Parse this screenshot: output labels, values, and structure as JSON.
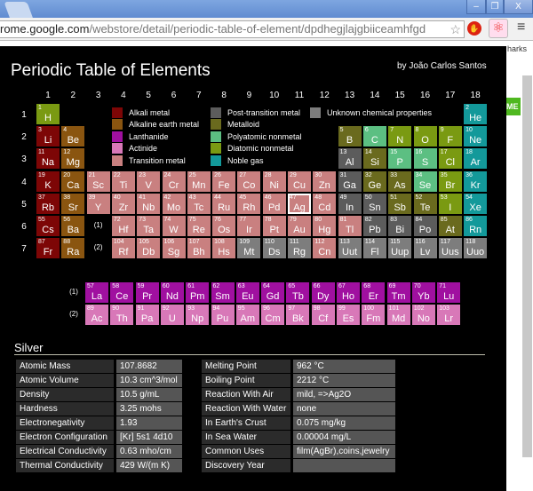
{
  "browser": {
    "url_host": "rome.google.com",
    "url_path": "/webstore/detail/periodic-table-of-element/dpdhegjlajgbiiceamhfgd",
    "bookmarks_partial": "harks",
    "page_button_partial": "ME",
    "window_buttons": [
      "–",
      "❐",
      "X"
    ]
  },
  "popup": {
    "title": "Periodic Table of Elements",
    "author": "by João Carlos Santos"
  },
  "colors": {
    "am": "#7d0606",
    "ae": "#8a5510",
    "la": "#a010a0",
    "ac": "#d878b8",
    "tm": "#c98080",
    "pt": "#5c5c5c",
    "ml": "#6a6a1e",
    "pn": "#5cbf82",
    "dn": "#7a9a12",
    "ng": "#13999a",
    "un": "#7d7d7d"
  },
  "legend": [
    {
      "cat": "am",
      "label": "Alkali metal"
    },
    {
      "cat": "ae",
      "label": "Alkaline earth metal"
    },
    {
      "cat": "la",
      "label": "Lanthanide"
    },
    {
      "cat": "ac",
      "label": "Actinide"
    },
    {
      "cat": "tm",
      "label": "Transition metal"
    },
    {
      "cat": "pt",
      "label": "Post-transition metal"
    },
    {
      "cat": "ml",
      "label": "Metalloid"
    },
    {
      "cat": "pn",
      "label": "Polyatomic nonmetal"
    },
    {
      "cat": "dn",
      "label": "Diatomic nonmetal"
    },
    {
      "cat": "ng",
      "label": "Noble gas"
    },
    {
      "cat": "un",
      "label": "Unknown chemical properties"
    }
  ],
  "groups": [
    "1",
    "2",
    "3",
    "4",
    "5",
    "6",
    "7",
    "8",
    "9",
    "10",
    "11",
    "12",
    "13",
    "14",
    "15",
    "16",
    "17",
    "18"
  ],
  "periods": [
    "1",
    "2",
    "3",
    "4",
    "5",
    "6",
    "7"
  ],
  "series_markers": [
    "(1)",
    "(2)"
  ],
  "selected": "47",
  "elements": [
    [
      "1",
      "H",
      "dn",
      1,
      1
    ],
    [
      "2",
      "He",
      "ng",
      18,
      1
    ],
    [
      "3",
      "Li",
      "am",
      1,
      2
    ],
    [
      "4",
      "Be",
      "ae",
      2,
      2
    ],
    [
      "5",
      "B",
      "ml",
      13,
      2
    ],
    [
      "6",
      "C",
      "pn",
      14,
      2
    ],
    [
      "7",
      "N",
      "dn",
      15,
      2
    ],
    [
      "8",
      "O",
      "dn",
      16,
      2
    ],
    [
      "9",
      "F",
      "dn",
      17,
      2
    ],
    [
      "10",
      "Ne",
      "ng",
      18,
      2
    ],
    [
      "11",
      "Na",
      "am",
      1,
      3
    ],
    [
      "12",
      "Mg",
      "ae",
      2,
      3
    ],
    [
      "13",
      "Al",
      "pt",
      13,
      3
    ],
    [
      "14",
      "Si",
      "ml",
      14,
      3
    ],
    [
      "15",
      "P",
      "pn",
      15,
      3
    ],
    [
      "16",
      "S",
      "pn",
      16,
      3
    ],
    [
      "17",
      "Cl",
      "dn",
      17,
      3
    ],
    [
      "18",
      "Ar",
      "ng",
      18,
      3
    ],
    [
      "19",
      "K",
      "am",
      1,
      4
    ],
    [
      "20",
      "Ca",
      "ae",
      2,
      4
    ],
    [
      "21",
      "Sc",
      "tm",
      3,
      4
    ],
    [
      "22",
      "Ti",
      "tm",
      4,
      4
    ],
    [
      "23",
      "V",
      "tm",
      5,
      4
    ],
    [
      "24",
      "Cr",
      "tm",
      6,
      4
    ],
    [
      "25",
      "Mn",
      "tm",
      7,
      4
    ],
    [
      "26",
      "Fe",
      "tm",
      8,
      4
    ],
    [
      "27",
      "Co",
      "tm",
      9,
      4
    ],
    [
      "28",
      "Ni",
      "tm",
      10,
      4
    ],
    [
      "29",
      "Cu",
      "tm",
      11,
      4
    ],
    [
      "30",
      "Zn",
      "tm",
      12,
      4
    ],
    [
      "31",
      "Ga",
      "pt",
      13,
      4
    ],
    [
      "32",
      "Ge",
      "ml",
      14,
      4
    ],
    [
      "33",
      "As",
      "ml",
      15,
      4
    ],
    [
      "34",
      "Se",
      "pn",
      16,
      4
    ],
    [
      "35",
      "Br",
      "dn",
      17,
      4
    ],
    [
      "36",
      "Kr",
      "ng",
      18,
      4
    ],
    [
      "37",
      "Rb",
      "am",
      1,
      5
    ],
    [
      "38",
      "Sr",
      "ae",
      2,
      5
    ],
    [
      "39",
      "Y",
      "tm",
      3,
      5
    ],
    [
      "40",
      "Zr",
      "tm",
      4,
      5
    ],
    [
      "41",
      "Nb",
      "tm",
      5,
      5
    ],
    [
      "42",
      "Mo",
      "tm",
      6,
      5
    ],
    [
      "43",
      "Tc",
      "tm",
      7,
      5
    ],
    [
      "44",
      "Ru",
      "tm",
      8,
      5
    ],
    [
      "45",
      "Rh",
      "tm",
      9,
      5
    ],
    [
      "46",
      "Pd",
      "tm",
      10,
      5
    ],
    [
      "47",
      "Ag",
      "tm",
      11,
      5
    ],
    [
      "48",
      "Cd",
      "tm",
      12,
      5
    ],
    [
      "49",
      "In",
      "pt",
      13,
      5
    ],
    [
      "50",
      "Sn",
      "pt",
      14,
      5
    ],
    [
      "51",
      "Sb",
      "ml",
      15,
      5
    ],
    [
      "52",
      "Te",
      "ml",
      16,
      5
    ],
    [
      "53",
      "I",
      "dn",
      17,
      5
    ],
    [
      "54",
      "Xe",
      "ng",
      18,
      5
    ],
    [
      "55",
      "Cs",
      "am",
      1,
      6
    ],
    [
      "56",
      "Ba",
      "ae",
      2,
      6
    ],
    [
      "72",
      "Hf",
      "tm",
      4,
      6
    ],
    [
      "73",
      "Ta",
      "tm",
      5,
      6
    ],
    [
      "74",
      "W",
      "tm",
      6,
      6
    ],
    [
      "75",
      "Re",
      "tm",
      7,
      6
    ],
    [
      "76",
      "Os",
      "tm",
      8,
      6
    ],
    [
      "77",
      "Ir",
      "tm",
      9,
      6
    ],
    [
      "78",
      "Pt",
      "tm",
      10,
      6
    ],
    [
      "79",
      "Au",
      "tm",
      11,
      6
    ],
    [
      "80",
      "Hg",
      "tm",
      12,
      6
    ],
    [
      "81",
      "Tl",
      "tm",
      13,
      6
    ],
    [
      "82",
      "Pb",
      "pt",
      14,
      6
    ],
    [
      "83",
      "Bi",
      "pt",
      15,
      6
    ],
    [
      "84",
      "Po",
      "pt",
      16,
      6
    ],
    [
      "85",
      "At",
      "ml",
      17,
      6
    ],
    [
      "86",
      "Rn",
      "ng",
      18,
      6
    ],
    [
      "87",
      "Fr",
      "am",
      1,
      7
    ],
    [
      "88",
      "Ra",
      "ae",
      2,
      7
    ],
    [
      "104",
      "Rf",
      "tm",
      4,
      7
    ],
    [
      "105",
      "Db",
      "tm",
      5,
      7
    ],
    [
      "106",
      "Sg",
      "tm",
      6,
      7
    ],
    [
      "107",
      "Bh",
      "tm",
      7,
      7
    ],
    [
      "108",
      "Hs",
      "tm",
      8,
      7
    ],
    [
      "109",
      "Mt",
      "un",
      9,
      7
    ],
    [
      "110",
      "Ds",
      "un",
      10,
      7
    ],
    [
      "111",
      "Rg",
      "un",
      11,
      7
    ],
    [
      "112",
      "Cn",
      "tm",
      12,
      7
    ],
    [
      "113",
      "Uut",
      "un",
      13,
      7
    ],
    [
      "114",
      "Fl",
      "un",
      14,
      7
    ],
    [
      "115",
      "Uup",
      "un",
      15,
      7
    ],
    [
      "116",
      "Lv",
      "un",
      16,
      7
    ],
    [
      "117",
      "Uus",
      "un",
      17,
      7
    ],
    [
      "118",
      "Uuo",
      "un",
      18,
      7
    ]
  ],
  "lanthanides": [
    [
      "57",
      "La"
    ],
    [
      "58",
      "Ce"
    ],
    [
      "59",
      "Pr"
    ],
    [
      "60",
      "Nd"
    ],
    [
      "61",
      "Pm"
    ],
    [
      "62",
      "Sm"
    ],
    [
      "63",
      "Eu"
    ],
    [
      "64",
      "Gd"
    ],
    [
      "65",
      "Tb"
    ],
    [
      "66",
      "Dy"
    ],
    [
      "67",
      "Ho"
    ],
    [
      "68",
      "Er"
    ],
    [
      "69",
      "Tm"
    ],
    [
      "70",
      "Yb"
    ],
    [
      "71",
      "Lu"
    ]
  ],
  "actinides": [
    [
      "89",
      "Ac"
    ],
    [
      "90",
      "Th"
    ],
    [
      "91",
      "Pa"
    ],
    [
      "92",
      "U"
    ],
    [
      "93",
      "Np"
    ],
    [
      "94",
      "Pu"
    ],
    [
      "95",
      "Am"
    ],
    [
      "96",
      "Cm"
    ],
    [
      "97",
      "Bk"
    ],
    [
      "98",
      "Cf"
    ],
    [
      "99",
      "Es"
    ],
    [
      "100",
      "Fm"
    ],
    [
      "101",
      "Md"
    ],
    [
      "102",
      "No"
    ],
    [
      "103",
      "Lr"
    ]
  ],
  "details": {
    "name": "Silver",
    "left": [
      [
        "Atomic Mass",
        "107.8682"
      ],
      [
        "Atomic Volume",
        "10.3 cm^3/mol"
      ],
      [
        "Density",
        "10.5 g/mL"
      ],
      [
        "Hardness",
        "3.25 mohs"
      ],
      [
        "Electronegativity",
        "1.93"
      ],
      [
        "Electron Configuration",
        "[Kr] 5s1 4d10"
      ],
      [
        "Electrical Conductivity",
        "0.63 mho/cm"
      ],
      [
        "Thermal Conductivity",
        "429 W/(m K)"
      ]
    ],
    "right": [
      [
        "Melting Point",
        "962 °C"
      ],
      [
        "Boiling Point",
        "2212 °C"
      ],
      [
        "Reaction With Air",
        "mild, =>Ag2O"
      ],
      [
        "Reaction With Water",
        "none"
      ],
      [
        "In Earth's Crust",
        "0.075 mg/kg"
      ],
      [
        "In Sea Water",
        "0.00004 mg/L"
      ],
      [
        "Common Uses",
        "film(AgBr),coins,jewelry"
      ],
      [
        "Discovery Year",
        ""
      ]
    ]
  }
}
